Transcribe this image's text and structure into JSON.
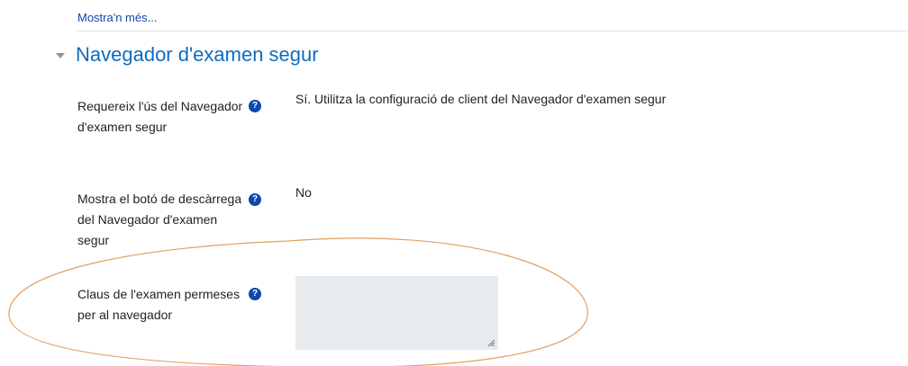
{
  "show_more": "Mostra'n més...",
  "section": {
    "title": "Navegador d'examen segur"
  },
  "rows": [
    {
      "label": "Requereix l'ús del Navegador d'examen segur",
      "value": "Sí. Utilitza la configuració de client del Navegador d'examen segur"
    },
    {
      "label": "Mostra el botó de descàrrega del Navegador d'examen segur",
      "value": "No"
    },
    {
      "label": "Claus de l'examen permeses per al navegador",
      "value": ""
    }
  ],
  "icons": {
    "help": "?"
  },
  "colors": {
    "link": "#0f47ad",
    "section_title": "#0f6cbf",
    "annotation": "#e0a060",
    "textarea_bg": "#e9ecef"
  }
}
